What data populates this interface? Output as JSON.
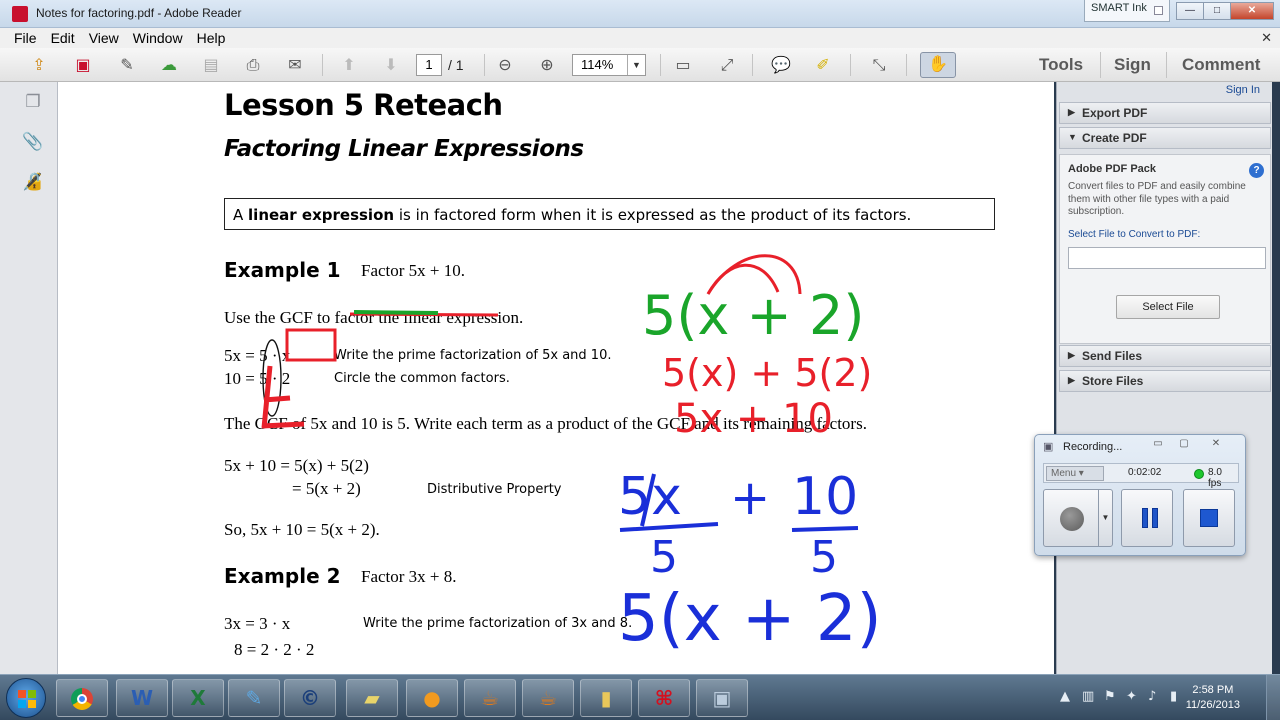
{
  "window": {
    "title": "Notes for factoring.pdf - Adobe Reader",
    "smart_ink": "SMART Ink",
    "minimize": "—",
    "maximize": "□",
    "close": "✕"
  },
  "menu": {
    "items": [
      "File",
      "Edit",
      "View",
      "Window",
      "Help"
    ],
    "close": "✕"
  },
  "toolbar": {
    "page_current": "1",
    "page_total": "/ 1",
    "zoom": "114%",
    "zoom_arrow": "▼",
    "right_buttons": [
      "Tools",
      "Sign",
      "Comment"
    ]
  },
  "document": {
    "lesson_title": "Lesson 5 Reteach",
    "subtitle": "Factoring Linear Expressions",
    "definition": {
      "prefix": "A ",
      "bold": "linear expression",
      "suffix": " is in factored form when it is expressed as the product of its factors."
    },
    "example1": {
      "heading": "Example 1",
      "task": "Factor 5x + 10.",
      "instruction": "Use the GCF to factor the linear expression.",
      "step1_math": "5x = 5 · x",
      "step1_note": "Write the prime factorization of 5x and 10.",
      "step2_math": "10 = 5 · 2",
      "step2_note": "Circle the common factors.",
      "gcf_text": "The GCF of 5x and 10 is 5. Write each term as a product of the GCF and its remaining factors.",
      "line1": "5x + 10 = 5(x) + 5(2)",
      "line2": "= 5(x + 2)",
      "line2_note": "Distributive Property",
      "conclusion": "So, 5x + 10 = 5(x + 2)."
    },
    "example2": {
      "heading": "Example 2",
      "task": "Factor 3x + 8.",
      "step1_math": "3x = 3 · x",
      "step1_note": "Write the prime factorization of 3x and 8.",
      "step2_math": "8 = 2 · 2 · 2"
    },
    "ink": {
      "green": "5(x + 2)",
      "red_line1": "5(x) + 5(2)",
      "red_line2": "5x + 10",
      "blue_top_left": "5x",
      "blue_top_right": "10",
      "blue_plus": "+",
      "blue_denominator": "5",
      "blue_result": "5(x + 2)",
      "colors": {
        "green": "#1aa52a",
        "red": "#e8202a",
        "blue": "#1a2fd8"
      }
    }
  },
  "right_panel": {
    "sign_in": "Sign In",
    "export_pdf": "Export PDF",
    "create_pdf": "Create PDF",
    "pack_title": "Adobe PDF Pack",
    "pack_desc": "Convert files to PDF and easily combine them with other file types with a paid subscription.",
    "select_label": "Select File to Convert to PDF:",
    "select_button": "Select File",
    "send_files": "Send Files",
    "store_files": "Store Files"
  },
  "recording": {
    "title": "Recording...",
    "menu": "Menu",
    "time": "0:02:02",
    "fps": "8.0 fps"
  },
  "taskbar": {
    "time": "2:58 PM",
    "date": "11/26/2013"
  }
}
